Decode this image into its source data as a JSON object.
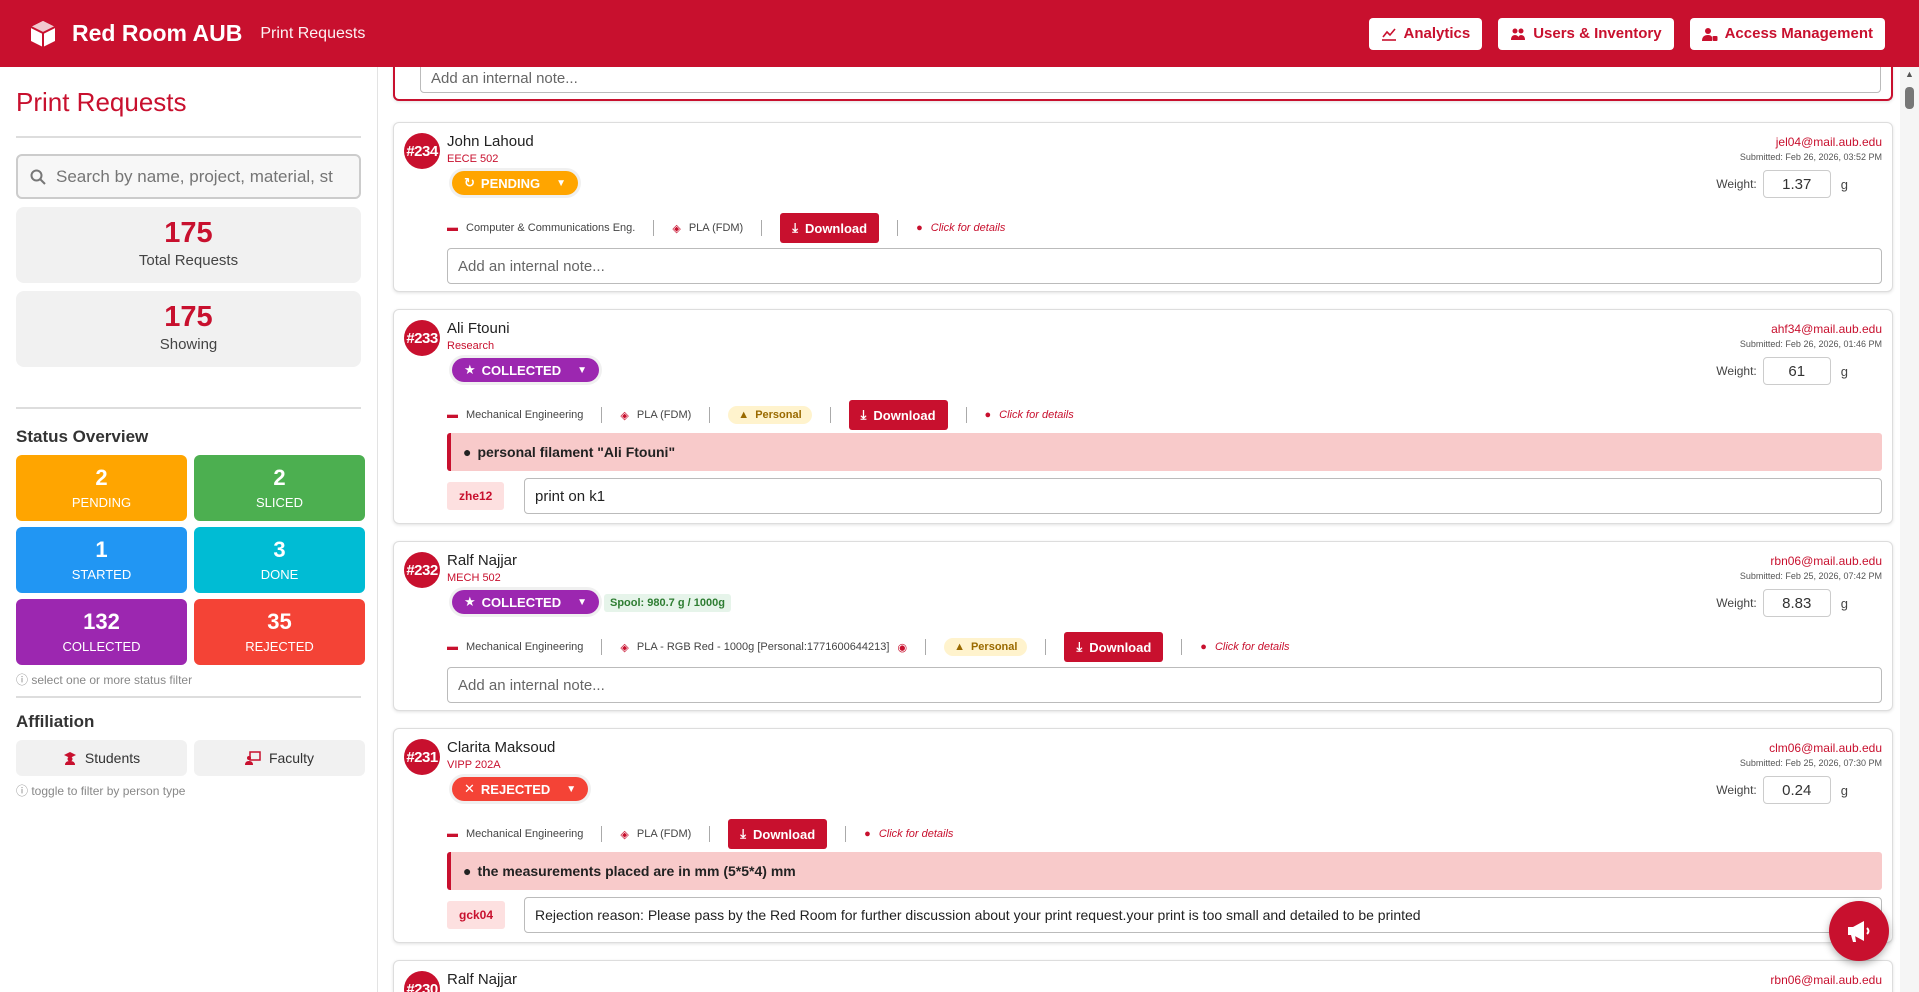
{
  "header": {
    "title": "Red Room AUB",
    "subtitle": "Print Requests",
    "actions": [
      {
        "label": "Analytics",
        "icon": "chart-line-icon"
      },
      {
        "label": "Users & Inventory",
        "icon": "users-icon"
      },
      {
        "label": "Access Management",
        "icon": "user-lock-icon"
      }
    ]
  },
  "sidebar": {
    "title": "Print Requests",
    "search_placeholder": "Search by name, project, material, st",
    "total": {
      "value": "175",
      "label": "Total Requests"
    },
    "showing": {
      "value": "175",
      "label": "Showing"
    },
    "status_title": "Status Overview",
    "statuses": [
      {
        "count": "2",
        "label": "PENDING",
        "color": "#ffa500"
      },
      {
        "count": "2",
        "label": "SLICED",
        "color": "#4caf50"
      },
      {
        "count": "1",
        "label": "STARTED",
        "color": "#2196f3"
      },
      {
        "count": "3",
        "label": "DONE",
        "color": "#00bcd4"
      },
      {
        "count": "132",
        "label": "COLLECTED",
        "color": "#9c27b0"
      },
      {
        "count": "35",
        "label": "REJECTED",
        "color": "#f44336"
      }
    ],
    "status_hint": "ⓘ select one or more status filter",
    "affiliation_title": "Affiliation",
    "affiliation": [
      {
        "label": "Students"
      },
      {
        "label": "Faculty"
      }
    ],
    "affiliation_hint": "ⓘ toggle to filter by person type"
  },
  "requests": {
    "top_note_placeholder": "Add an internal note...",
    "r234": {
      "id": "#234",
      "name": "John Lahoud",
      "course": "EECE 502",
      "status": "PENDING",
      "email": "jel04@mail.aub.edu",
      "submitted": "Submitted: Feb 26, 2026, 03:52 PM",
      "weight_label": "Weight:",
      "weight": "1.37",
      "unit": "g",
      "department": "Computer & Communications Eng.",
      "material": "PLA (FDM)",
      "download": "Download",
      "details": "Click for details",
      "note_placeholder": "Add an internal note..."
    },
    "r233": {
      "id": "#233",
      "name": "Ali Ftouni",
      "course": "Research",
      "status": "COLLECTED",
      "email": "ahf34@mail.aub.edu",
      "submitted": "Submitted: Feb 26, 2026, 01:46 PM",
      "weight_label": "Weight:",
      "weight": "61",
      "unit": "g",
      "department": "Mechanical Engineering",
      "material": "PLA (FDM)",
      "personal": "Personal",
      "download": "Download",
      "details": "Click for details",
      "comment": "personal filament \"Ali Ftouni\"",
      "staff": "zhe12",
      "staff_note": "print on k1"
    },
    "r232": {
      "id": "#232",
      "name": "Ralf Najjar",
      "course": "MECH 502",
      "status": "COLLECTED",
      "spool": "Spool: 980.7 g / 1000g",
      "email": "rbn06@mail.aub.edu",
      "submitted": "Submitted: Feb 25, 2026, 07:42 PM",
      "weight_label": "Weight:",
      "weight": "8.83",
      "unit": "g",
      "department": "Mechanical Engineering",
      "material": "PLA - RGB Red - 1000g [Personal:1771600644213]",
      "personal": "Personal",
      "download": "Download",
      "details": "Click for details",
      "note_placeholder": "Add an internal note..."
    },
    "r231": {
      "id": "#231",
      "name": "Clarita Maksoud",
      "course": "VIPP 202A",
      "status": "REJECTED",
      "email": "clm06@mail.aub.edu",
      "submitted": "Submitted: Feb 25, 2026, 07:30 PM",
      "weight_label": "Weight:",
      "weight": "0.24",
      "unit": "g",
      "department": "Mechanical Engineering",
      "material": "PLA (FDM)",
      "download": "Download",
      "details": "Click for details",
      "comment": "the measurements placed are in mm (5*5*4) mm",
      "staff": "gck04",
      "staff_note": "Rejection reason: Please pass by the Red Room for further discussion about your print request.your print is too small and detailed to be printed"
    },
    "r230": {
      "id": "#230",
      "name": "Ralf Najjar",
      "email": "rbn06@mail.aub.edu"
    }
  }
}
